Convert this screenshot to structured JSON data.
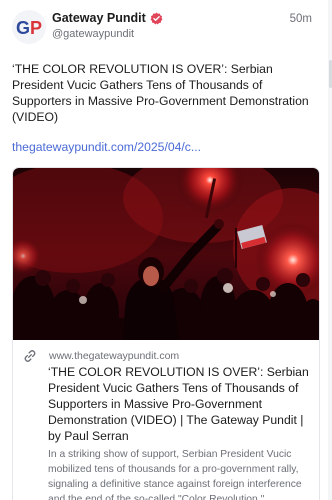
{
  "post": {
    "account": {
      "display_name": "Gateway Pundit",
      "handle": "@gatewaypundit",
      "avatar_text": "GP",
      "verified_icon": "verified-badge-icon"
    },
    "timestamp": "50m",
    "text": "‘THE COLOR REVOLUTION IS OVER’: Serbian President Vucic Gathers Tens of Thousands of Supporters in Massive Pro-Government Demonstration (VIDEO)",
    "link_text": "thegatewaypundit.com/2025/04/c...",
    "card": {
      "domain": "www.thegatewaypundit.com",
      "title": "‘THE COLOR REVOLUTION IS OVER’: Serbian President Vucic Gathers Tens of Thousands of Supporters in Massive Pro-Government Demonstration (VIDEO) | The Gateway Pundit | by Paul Serran",
      "description": "In a striking show of support, Serbian President Vucic mobilized tens of thousands for a pro-government rally, signaling a definitive stance against foreign interference and the end of the so-called \"Color Revolution.\"",
      "link_icon": "link-icon",
      "image_subject": "crowd-with-red-flares-photo"
    }
  },
  "colors": {
    "link": "#4b6bd6",
    "verified": "#e0455a",
    "avatar_blue": "#2d4a9c",
    "avatar_red": "#d9343a"
  }
}
